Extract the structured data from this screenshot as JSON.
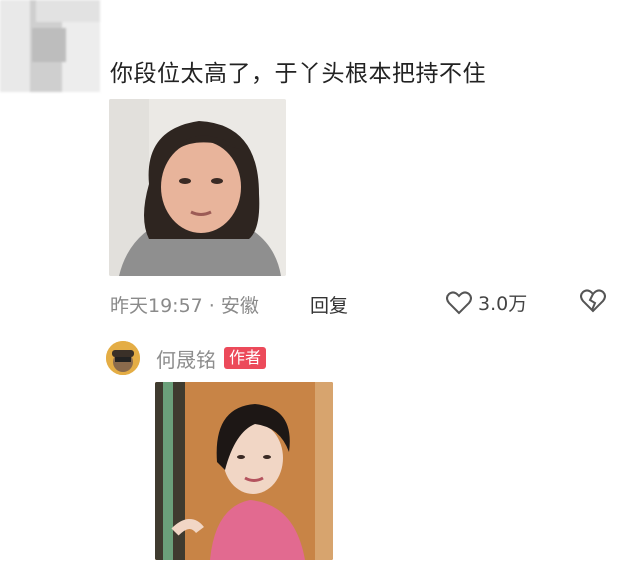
{
  "comment": {
    "text": "你段位太高了，于丫头根本把持不住",
    "time_location": "昨天19:57 · 安徽",
    "reply_label": "回复",
    "like_count": "3.0万"
  },
  "reply": {
    "author_name": "何晟铭",
    "author_badge": "作者"
  },
  "icons": {
    "like": "heart-outline-icon",
    "dislike": "broken-heart-icon"
  },
  "colors": {
    "badge": "#ec4a5a",
    "meta_text": "#8a8a8a"
  }
}
